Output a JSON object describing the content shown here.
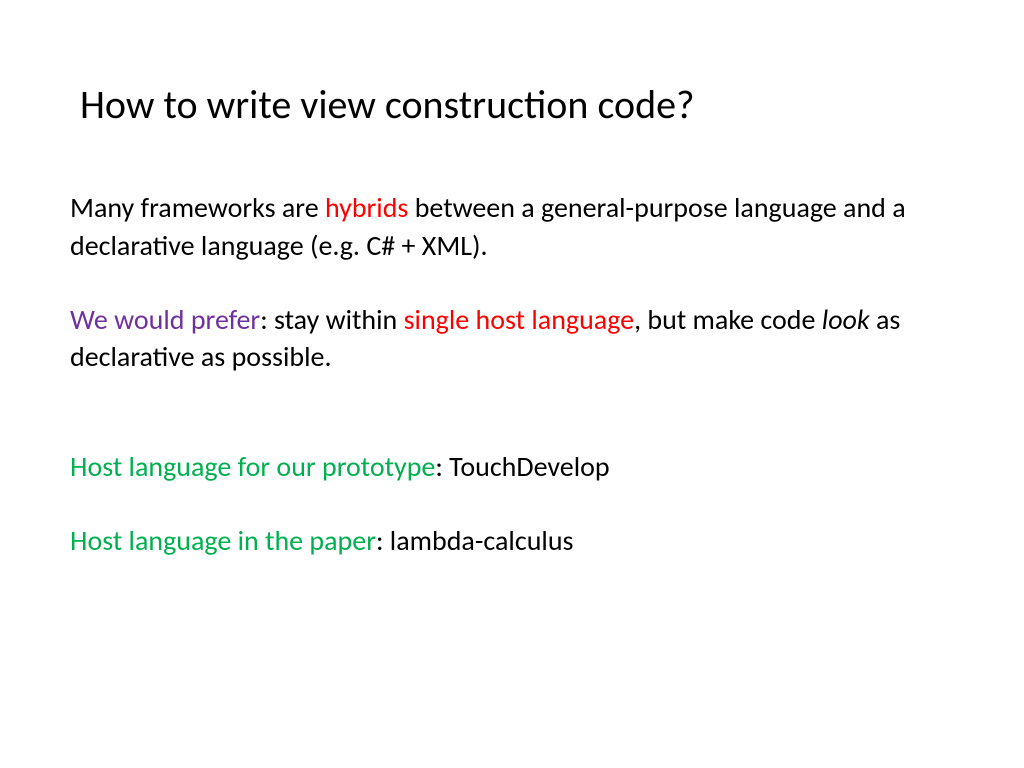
{
  "title": "How to write view construction code?",
  "p1": {
    "t1": "Many frameworks are ",
    "t2": "hybrids",
    "t3": " between a general-purpose language and a declarative language (e.g. C# + XML)."
  },
  "p2": {
    "t1": "We would prefer",
    "t2": ": stay within ",
    "t3": "single host language",
    "t4": ", but make code ",
    "t5": "look",
    "t6": " as declarative as possible."
  },
  "p3": {
    "t1": "Host language for our prototype",
    "t2": ": TouchDevelop"
  },
  "p4": {
    "t1": "Host language in the paper",
    "t2": ": lambda-calculus"
  }
}
